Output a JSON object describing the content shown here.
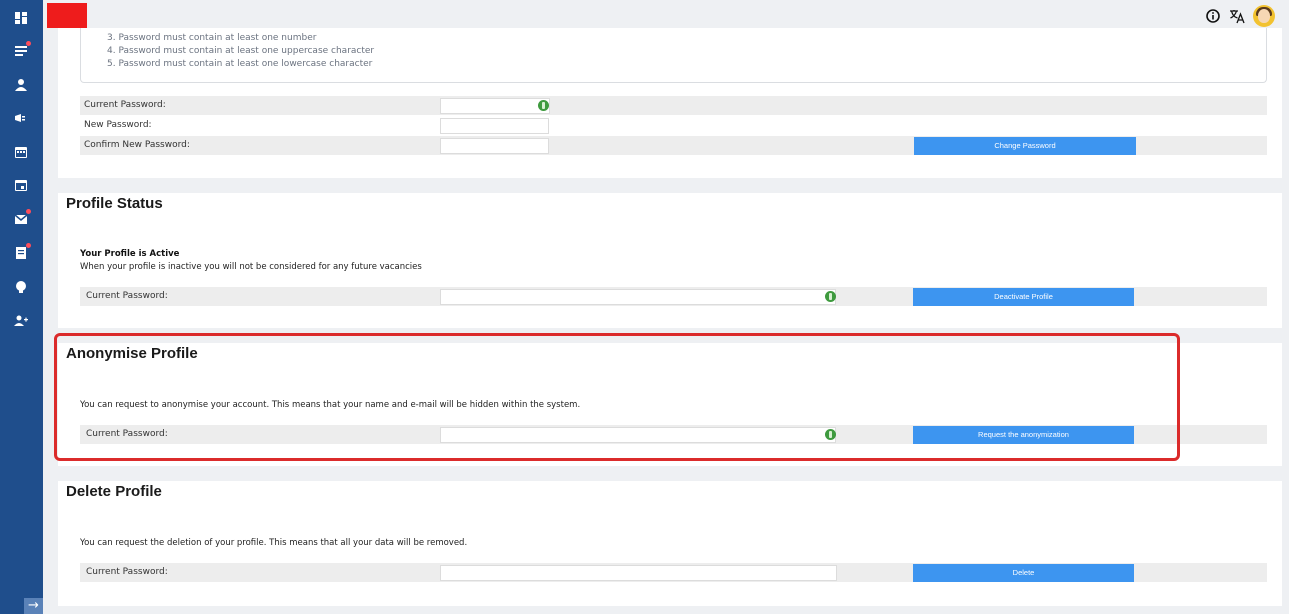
{
  "colors": {
    "sidebar": "#1f4e8c",
    "logo": "#ee1c1c",
    "button": "#3d95f0",
    "highlight": "#db2b2b",
    "eye_icon": "#3e9a3e"
  },
  "sidebar": {
    "icons": [
      "dashboard-icon",
      "list-icon",
      "user-icon",
      "megaphone-icon",
      "calendar-icon",
      "calendar-event-icon",
      "mail-icon",
      "document-icon",
      "lightbulb-icon",
      "group-add-icon"
    ],
    "expand_icon": "arrow-right-icon",
    "expand_label": "→"
  },
  "header": {
    "icons": [
      "info-icon",
      "translate-icon",
      "avatar"
    ]
  },
  "password_change": {
    "rules": [
      "3. Password must contain at least one number",
      "4. Password must contain at least one uppercase character",
      "5. Password must contain at least one lowercase character"
    ],
    "current_label": "Current Password:",
    "new_label": "New Password:",
    "confirm_label": "Confirm New Password:",
    "button": "Change Password"
  },
  "profile_status": {
    "title": "Profile Status",
    "status": "Your Profile is Active",
    "description": "When your profile is inactive you will not be considered for any future vacancies",
    "password_label": "Current Password:",
    "button": "Deactivate Profile"
  },
  "anonymise": {
    "title": "Anonymise Profile",
    "description": "You can request to anonymise your account. This means that your name and e-mail will be hidden within the system.",
    "password_label": "Current Password:",
    "button": "Request the anonymization"
  },
  "delete_profile": {
    "title": "Delete Profile",
    "description": "You can request the deletion of your profile. This means that all your data will be removed.",
    "password_label": "Current Password:",
    "button": "Delete"
  }
}
